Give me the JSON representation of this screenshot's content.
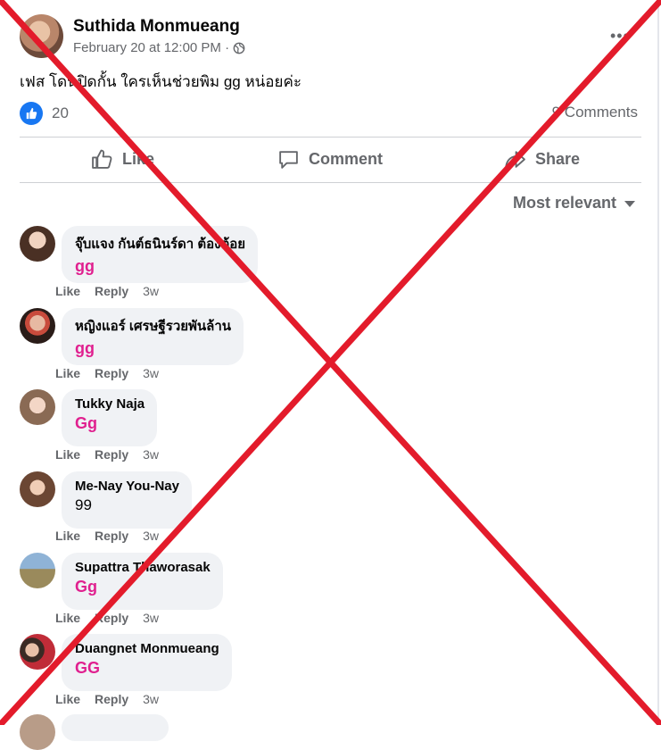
{
  "post": {
    "author": "Suthida Monmueang",
    "date": "February 20 at 12:00 PM ·",
    "text": "เฟส โดนปิดกั้น ใครเห็นช่วยพิม gg หน่อยค่ะ",
    "like_count": "20",
    "comments_count": "9 Comments"
  },
  "actions": {
    "like": "Like",
    "comment": "Comment",
    "share": "Share"
  },
  "sort_label": "Most relevant",
  "comments": [
    {
      "name": "จุ๊บแจง กันต์ธนินร์ดา ต้องต้อย",
      "text": "gg",
      "highlight": true,
      "like": "Like",
      "reply": "Reply",
      "time": "3w"
    },
    {
      "name": "หญิงแอร์ เศรษฐีรวยพันล้าน",
      "text": "gg",
      "highlight": true,
      "like": "Like",
      "reply": "Reply",
      "time": "3w"
    },
    {
      "name": "Tukky Naja",
      "text": "Gg",
      "highlight": true,
      "like": "Like",
      "reply": "Reply",
      "time": "3w"
    },
    {
      "name": "Me-Nay You-Nay",
      "text": "99",
      "highlight": false,
      "like": "Like",
      "reply": "Reply",
      "time": "3w"
    },
    {
      "name": "Supattra Thaworasak",
      "text": "Gg",
      "highlight": true,
      "like": "Like",
      "reply": "Reply",
      "time": "3w"
    },
    {
      "name": "Duangnet Monmueang",
      "text": "GG",
      "highlight": true,
      "like": "Like",
      "reply": "Reply",
      "time": "3w"
    }
  ],
  "colors": {
    "accent": "#1877f2",
    "highlight_text": "#e0208f",
    "cross": "#e31b2b"
  },
  "icons": [
    "globe-icon",
    "more-icon",
    "like-icon",
    "comment-icon",
    "share-icon",
    "caret-down-icon",
    "thumbs-up-badge-icon"
  ]
}
